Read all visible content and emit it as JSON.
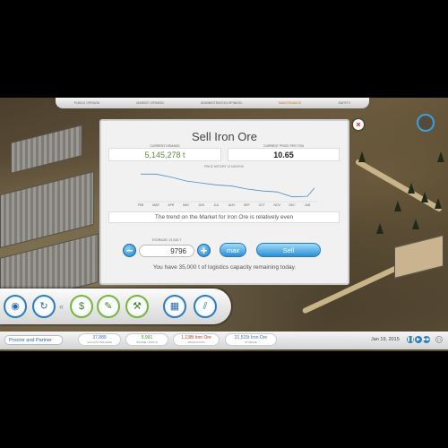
{
  "top_menu": {
    "items": [
      "PUBLIC OPINION",
      "MARKET OPINION",
      "ADMINISTRATION OPINION",
      "MAINTENANCE",
      "SAFETY"
    ],
    "active_index": 3
  },
  "dialog": {
    "title": "Sell Iron Ore",
    "close_symbol": "×",
    "current_demand_label": "CURRENT DEMAND",
    "current_demand_value": "5,145,278 t",
    "current_price_label": "CURRENT PRICE PER TON",
    "current_price_value": "10.65",
    "trend_text": "The trend on the Market for Iron Ore is relatively even",
    "storage_label": "STORAGE: 21,515 T",
    "quantity_value": "9796",
    "minus_symbol": "−",
    "plus_symbol": "+",
    "max_label": "max",
    "sell_label": "Sell",
    "capacity_text": "You have 35,000 t of logistics capacity remaining today."
  },
  "chart_data": {
    "type": "line",
    "title": "PRICE HISTORY 12 MONTHS",
    "categories": [
      "FEB",
      "MAR",
      "APR",
      "MAY",
      "JUN",
      "JUL",
      "AUG",
      "SEP",
      "OCT",
      "NOV",
      "DEC",
      "JAN"
    ],
    "values": [
      12.9,
      12.9,
      12.6,
      12.2,
      12.0,
      11.8,
      11.7,
      11.4,
      11.2,
      11.1,
      10.6,
      10.65
    ],
    "extra_point": 11.5,
    "ylim": [
      10.3,
      13.2
    ],
    "color": "#4a8fc4"
  },
  "toolbar": {
    "buttons": [
      {
        "name": "globe-button",
        "glyph": "◉",
        "style": "blue"
      },
      {
        "name": "refresh-button",
        "glyph": "↻",
        "style": "blue"
      },
      {
        "name": "finance-button",
        "glyph": "$",
        "style": "green"
      },
      {
        "name": "contract-button",
        "glyph": "✎",
        "style": "green"
      },
      {
        "name": "build-button",
        "glyph": "⚒",
        "style": "green"
      },
      {
        "name": "buildings-button",
        "glyph": "▦",
        "style": "blue"
      },
      {
        "name": "rail-button",
        "glyph": "⫽",
        "style": "blue"
      }
    ],
    "collapse_symbol": "«"
  },
  "status_bar": {
    "company": "Proctor and Partner",
    "pills": [
      {
        "value": "37,889",
        "label": "ACCOUNT BALANCE",
        "color": "#3a6fb0"
      },
      {
        "value": "5,991",
        "label": "INCOME / MONTH",
        "color": "#3f8f2a"
      },
      {
        "value": "1,138t Iron Ore",
        "label": "PRODUCTION",
        "color": "#b33a2a"
      },
      {
        "value": "21,515t Iron Ore",
        "label": "STORAGE",
        "color": "#3a6fb0"
      }
    ],
    "date": "Jan 19, 2015",
    "speed_buttons": [
      "❚❚",
      "▶",
      "▶▶"
    ],
    "menu_symbol": "⏻"
  }
}
